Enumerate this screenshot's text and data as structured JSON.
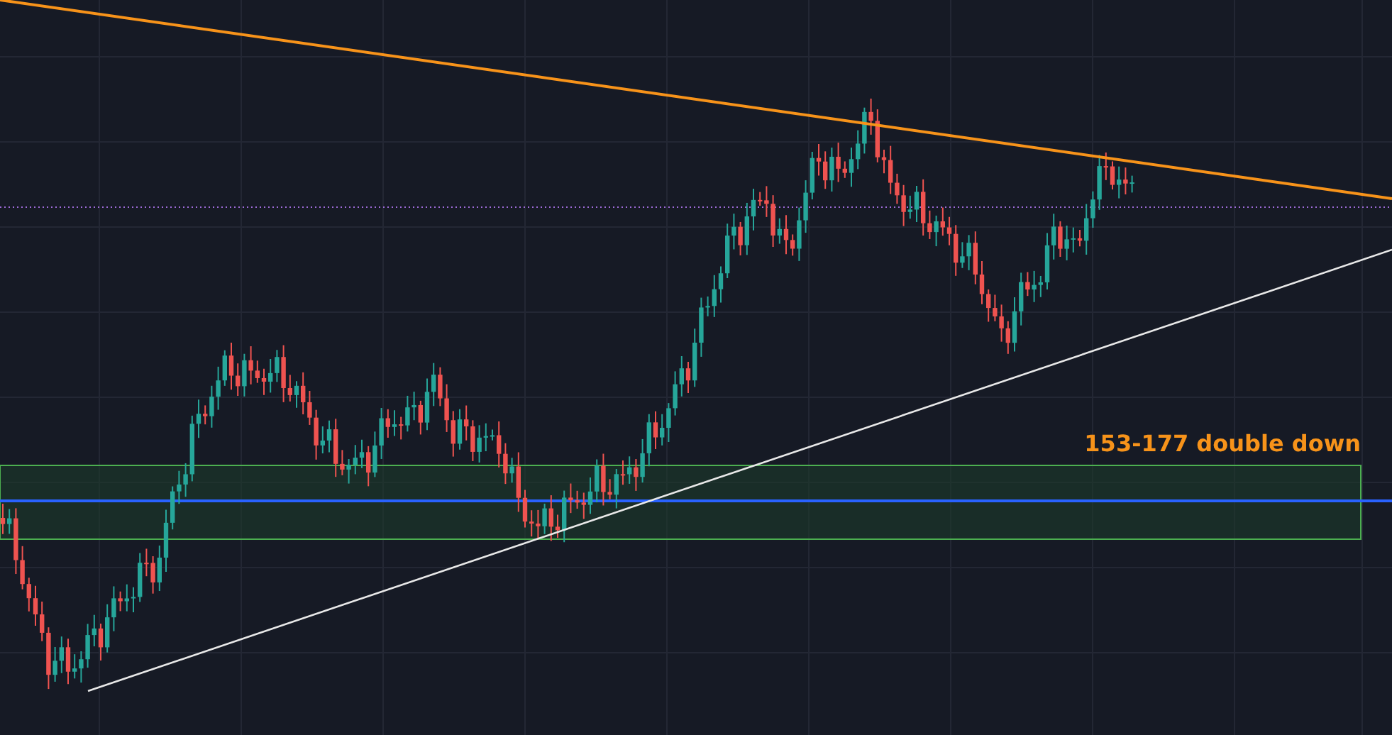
{
  "chart": {
    "annotation": "153-177 double down"
  }
}
